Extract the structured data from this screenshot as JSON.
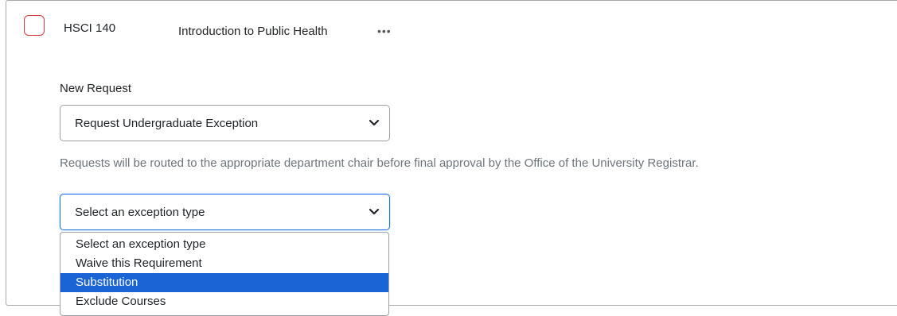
{
  "course": {
    "code": "HSCI 140",
    "title": "Introduction to Public Health",
    "more_icon": "•••"
  },
  "new_request": {
    "label": "New Request",
    "selected_value": "Request Undergraduate Exception"
  },
  "help_text": "Requests will be routed to the appropriate department chair before final approval by the Office of the University Registrar.",
  "exception_type": {
    "selected_value": "Select an exception type",
    "options": [
      {
        "label": "Select an exception type",
        "highlighted": false
      },
      {
        "label": "Waive this Requirement",
        "highlighted": false
      },
      {
        "label": "Substitution",
        "highlighted": true
      },
      {
        "label": "Exclude Courses",
        "highlighted": false
      }
    ]
  },
  "colors": {
    "checkbox_border": "#d9363e",
    "focus_border": "#1a73e8",
    "highlight": "#1a64d6",
    "help_text": "#6c757d"
  },
  "icons": {
    "checkbox": "checkbox-icon",
    "more": "more-options-icon",
    "chevron": "chevron-down-icon"
  }
}
